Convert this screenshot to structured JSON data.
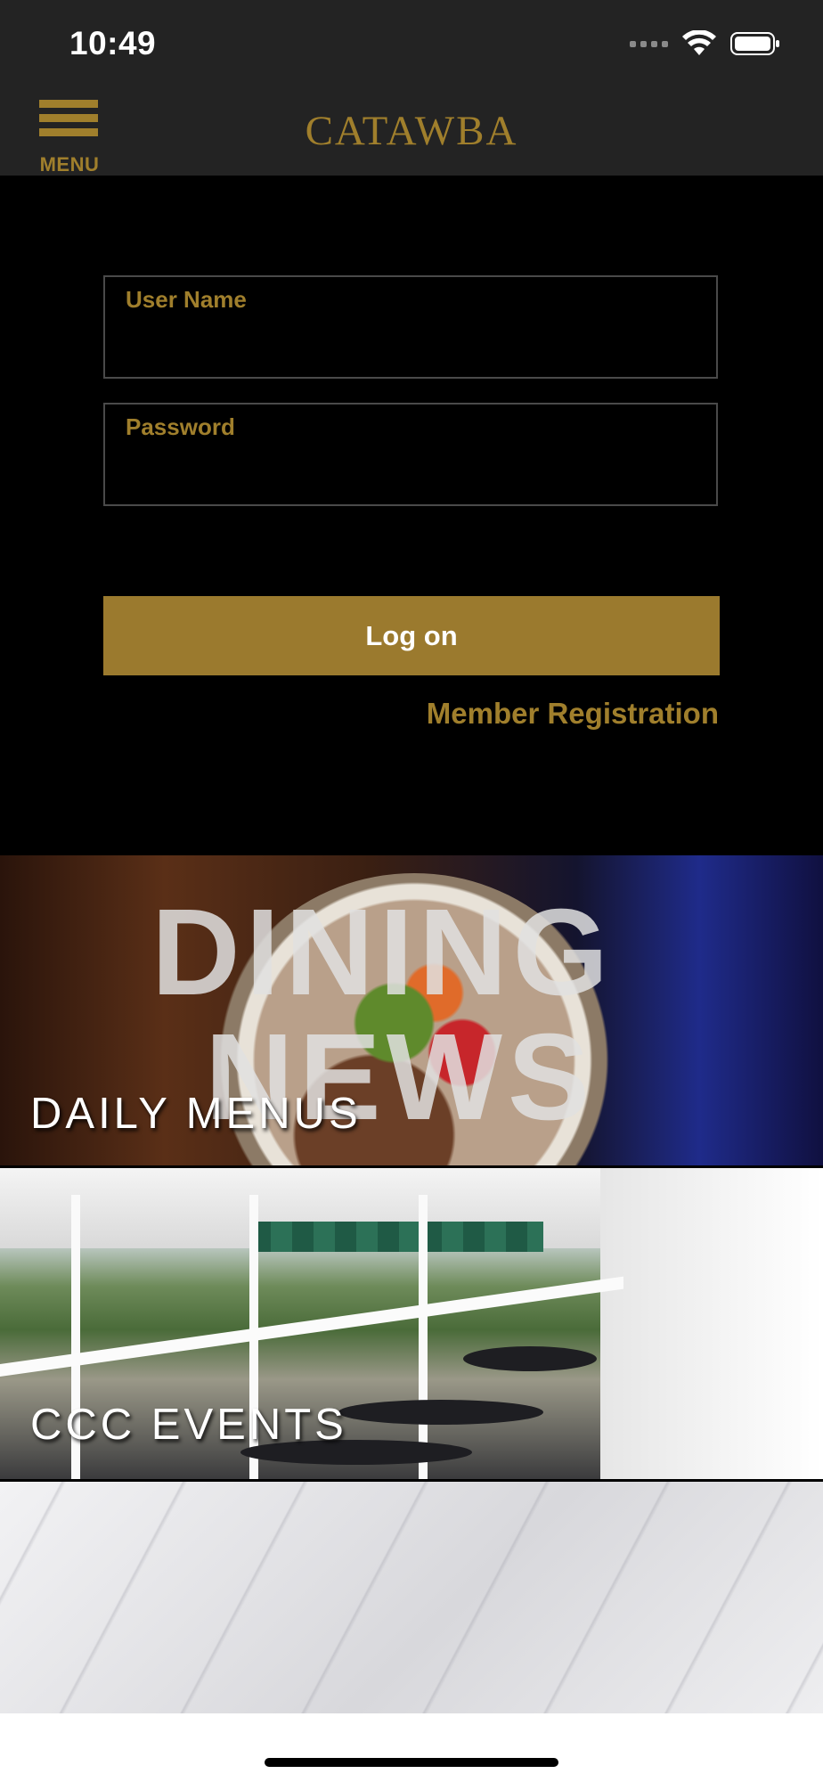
{
  "status_bar": {
    "time": "10:49",
    "icons": [
      "signal-dots-icon",
      "wifi-icon",
      "battery-icon"
    ]
  },
  "header": {
    "menu_label": "MENU",
    "brand": "CATAWBA"
  },
  "login": {
    "username_label": "User Name",
    "username_value": "",
    "password_label": "Password",
    "password_value": "",
    "logon_label": "Log on",
    "registration_label": "Member Registration"
  },
  "tiles": [
    {
      "label": "DAILY MENUS",
      "image_text": [
        "DINING",
        "NEWS"
      ]
    },
    {
      "label": "CCC EVENTS"
    },
    {
      "label": ""
    }
  ],
  "colors": {
    "accent_gold": "#a07f2c",
    "button_gold": "#9b7a2e",
    "header_bg": "#232323",
    "page_bg": "#000000"
  }
}
